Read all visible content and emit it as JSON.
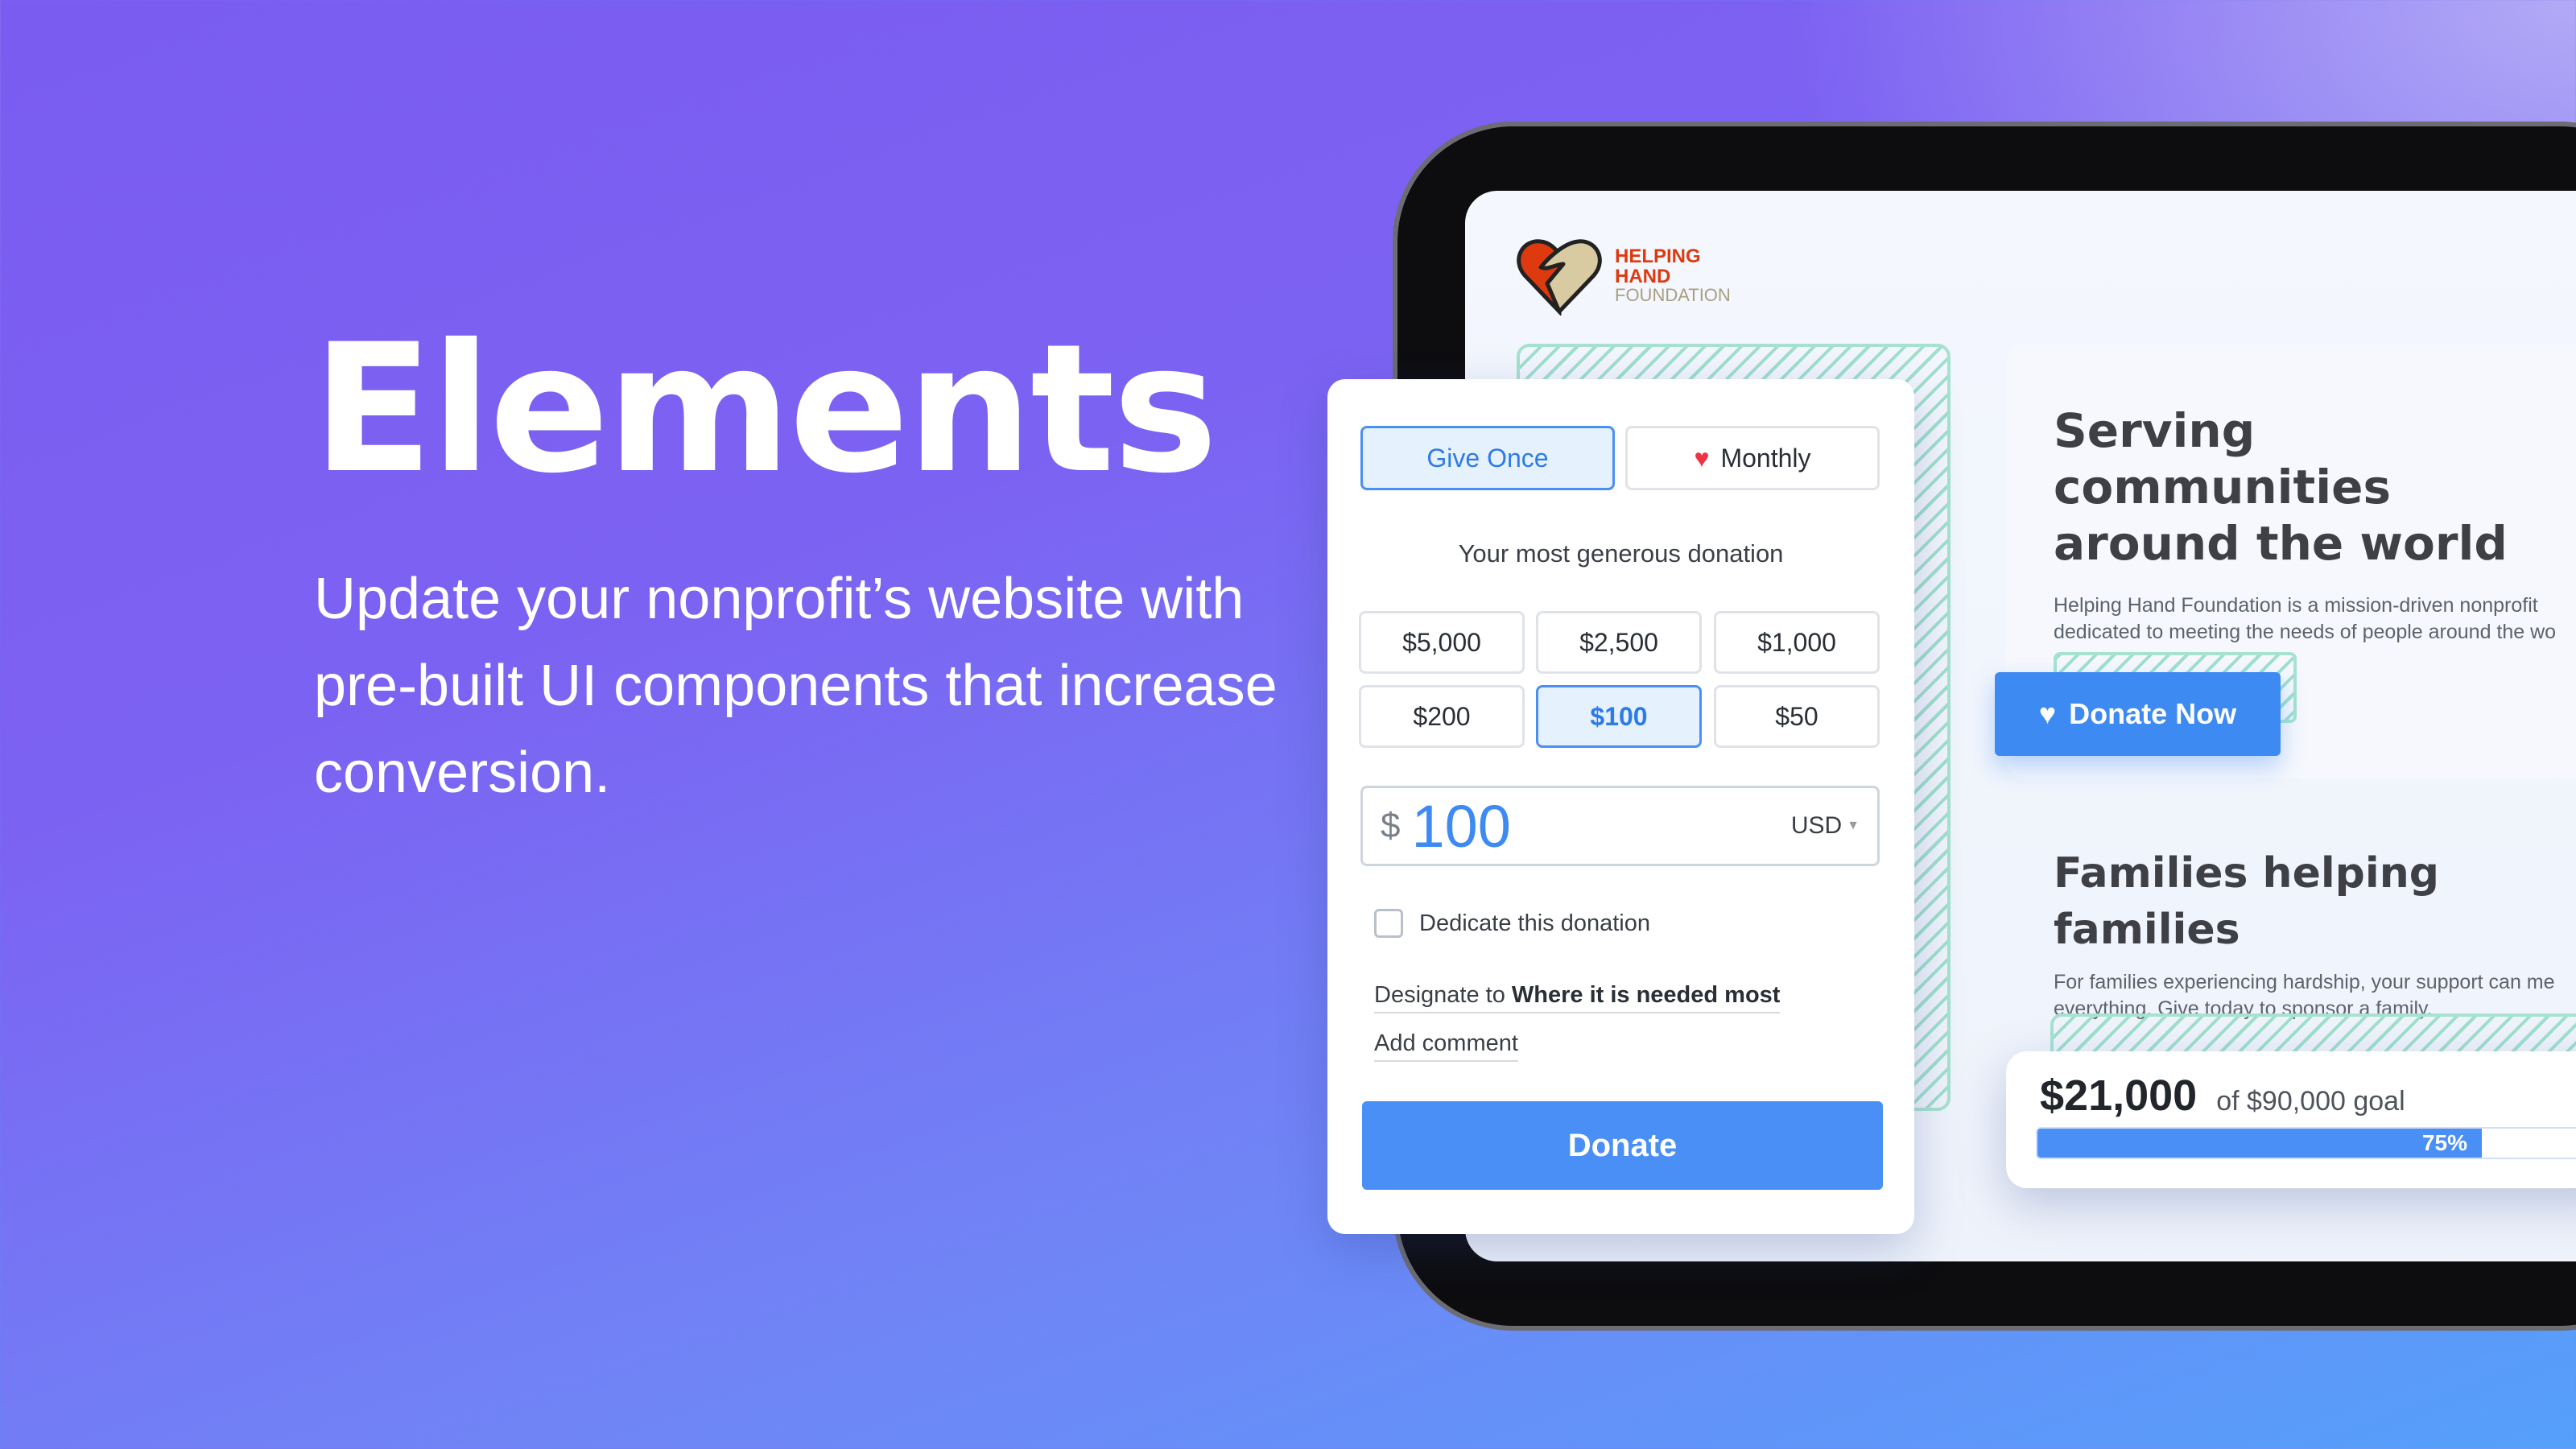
{
  "hero": {
    "title": "Elements",
    "subtitle": "Update your nonprofit’s website with pre-built UI components that increase conversion."
  },
  "logo": {
    "line1": "HELPING",
    "line2": "HAND",
    "line3": "FOUNDATION"
  },
  "donation_form": {
    "tabs": [
      {
        "label": "Give Once",
        "selected": true
      },
      {
        "label": "Monthly",
        "icon": "heart-icon",
        "selected": false
      }
    ],
    "prompt": "Your most generous donation",
    "amounts": [
      {
        "label": "$5,000"
      },
      {
        "label": "$2,500"
      },
      {
        "label": "$1,000"
      },
      {
        "label": "$200"
      },
      {
        "label": "$100",
        "selected": true
      },
      {
        "label": "$50"
      }
    ],
    "currency_symbol": "$",
    "amount_value": "100",
    "currency": "USD",
    "dedicate_label": "Dedicate this donation",
    "dedicate_checked": false,
    "designate_prefix": "Designate to",
    "designate_value": "Where it is needed most",
    "add_comment": "Add comment",
    "donate_label": "Donate"
  },
  "section1": {
    "heading_line1": "Serving communities",
    "heading_line2": "around the world",
    "body_line1": "Helping Hand Foundation is a mission-driven nonprofit",
    "body_line2": "dedicated to meeting the needs of people around the wo",
    "button": "Donate Now"
  },
  "section2": {
    "heading": "Families helping families",
    "body_line1": "For families experiencing hardship, your support can me",
    "body_line2": "everything. Give today to sponsor a family."
  },
  "goal": {
    "raised": "$21,000",
    "goal_text": "of $90,000 goal",
    "percent_label": "75%",
    "percent": 75
  },
  "colors": {
    "accent": "#4a8ff5",
    "brand_red": "#dd3a10",
    "hatch": "#9fe0cc"
  }
}
